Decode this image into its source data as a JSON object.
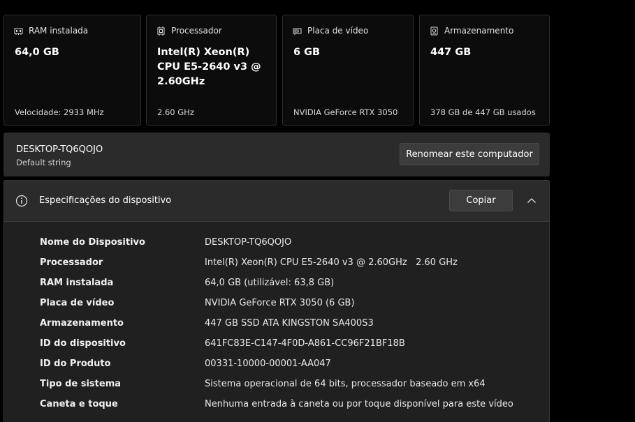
{
  "cards": [
    {
      "icon": "ram-icon",
      "label": "RAM instalada",
      "value": "64,0 GB",
      "foot": "Velocidade: 2933 MHz"
    },
    {
      "icon": "processor-icon",
      "label": "Processador",
      "value": "Intel(R) Xeon(R) CPU E5-2640 v3 @ 2.60GHz",
      "foot": "2.60 GHz"
    },
    {
      "icon": "gpu-icon",
      "label": "Placa de vídeo",
      "value": "6 GB",
      "foot": "NVIDIA GeForce RTX 3050"
    },
    {
      "icon": "storage-icon",
      "label": "Armazenamento",
      "value": "447 GB",
      "foot": "378 GB de 447 GB usados"
    }
  ],
  "computer": {
    "name": "DESKTOP-TQ6QOJO",
    "subtitle": "Default string",
    "rename_label": "Renomear este computador"
  },
  "specs": {
    "title": "Especificações do dispositivo",
    "copy_label": "Copiar",
    "rows": [
      {
        "key": "Nome do Dispositivo",
        "value": "DESKTOP-TQ6QOJO"
      },
      {
        "key": "Processador",
        "value": "Intel(R) Xeon(R) CPU E5-2640 v3 @ 2.60GHz   2.60 GHz"
      },
      {
        "key": "RAM instalada",
        "value": "64,0 GB (utilizável: 63,8 GB)"
      },
      {
        "key": "Placa de vídeo",
        "value": "NVIDIA GeForce RTX 3050 (6 GB)"
      },
      {
        "key": "Armazenamento",
        "value": "447 GB SSD ATA KINGSTON SA400S3"
      },
      {
        "key": "ID do dispositivo",
        "value": "641FC83E-C147-4F0D-A861-CC96F21BF18B"
      },
      {
        "key": "ID do Produto",
        "value": "00331-10000-00001-AA047"
      },
      {
        "key": "Tipo de sistema",
        "value": "Sistema operacional de 64 bits, processador baseado em x64"
      },
      {
        "key": "Caneta e toque",
        "value": "Nenhuma entrada à caneta ou por toque disponível para este vídeo"
      }
    ]
  },
  "colors": {
    "background": "#000000",
    "card": "#0c0c0c",
    "panel": "#2b2b2b",
    "button": "#3c3c3c"
  }
}
